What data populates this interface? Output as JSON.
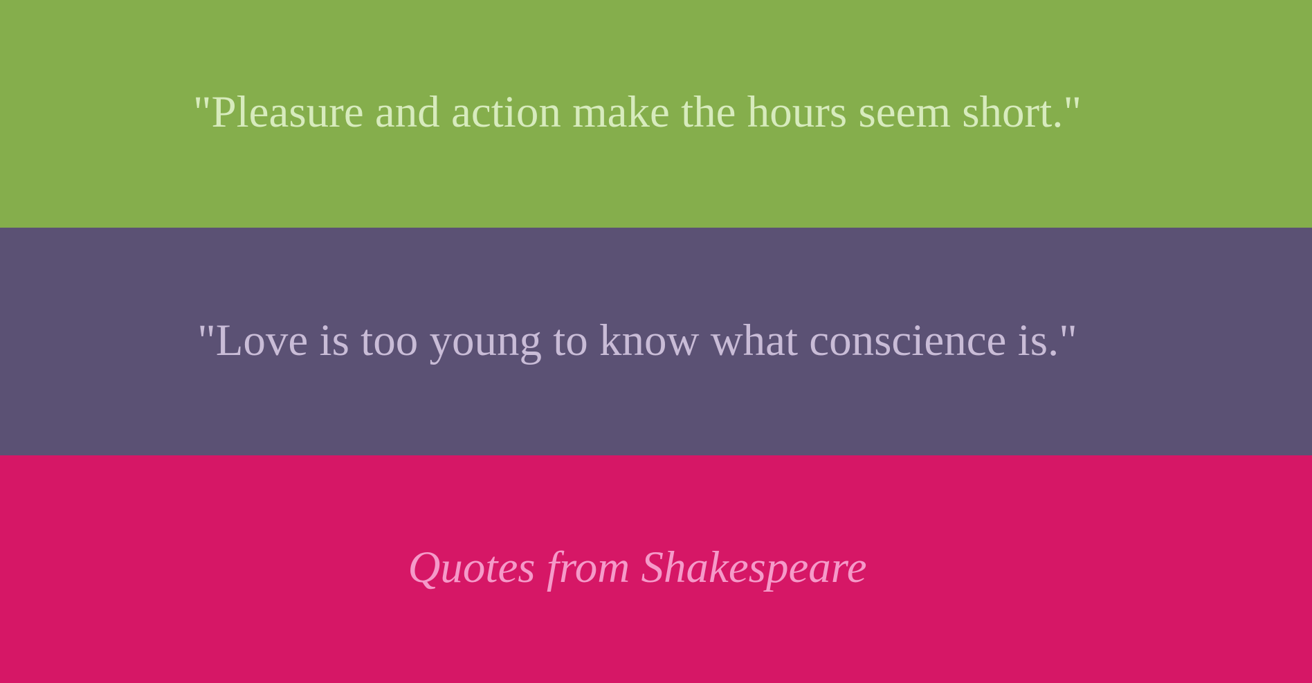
{
  "quotes": [
    {
      "text": "\"Pleasure and action make the hours seem short.\"",
      "background": "#85ae4c",
      "color": "#d7ebbd"
    },
    {
      "text": "\"Love is too young to know what conscience is.\"",
      "background": "#5b5174",
      "color": "#c9bcd7"
    }
  ],
  "footer": {
    "text": "Quotes from Shakespeare",
    "background": "#d61766",
    "color": "#f59ac9"
  }
}
